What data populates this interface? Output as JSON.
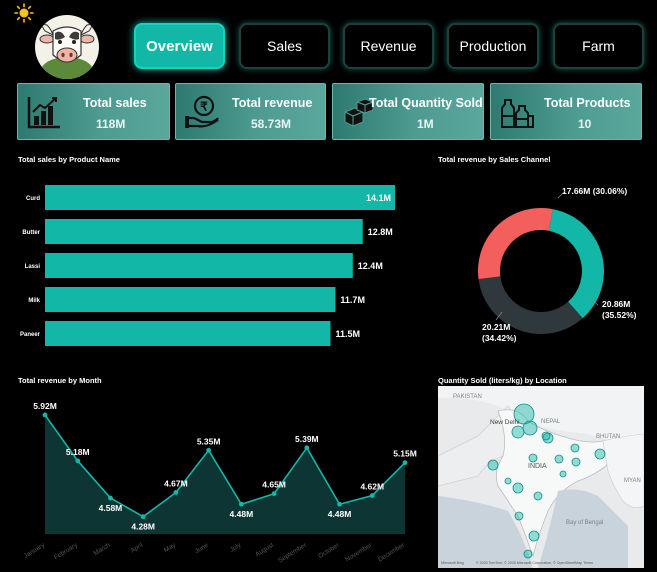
{
  "nav": {
    "tabs": [
      {
        "label": "Overview",
        "active": true
      },
      {
        "label": "Sales"
      },
      {
        "label": "Revenue"
      },
      {
        "label": "Production"
      },
      {
        "label": "Farm"
      }
    ]
  },
  "kpis": [
    {
      "title": "Total sales",
      "value": "118M",
      "icon": "bar-chart-icon"
    },
    {
      "title": "Total revenue",
      "value": "58.73M",
      "icon": "rupee-hand-icon"
    },
    {
      "title": "Total Quantity Sold",
      "value": "1M",
      "icon": "boxes-icon"
    },
    {
      "title": "Total Products",
      "value": "10",
      "icon": "milk-bottles-icon"
    }
  ],
  "colors": {
    "accent": "#13b7a8",
    "red": "#f25f5c",
    "dark": "#2f383d"
  },
  "sales_by_product": {
    "title": "Total sales by Product Name"
  },
  "revenue_by_channel": {
    "title": "Total revenue by Sales Channel"
  },
  "revenue_by_month": {
    "title": "Total revenue by Month"
  },
  "map": {
    "title": "Quantity Sold (liters/kg) by Location",
    "labels": {
      "pakistan": "PAKISTAN",
      "new_delhi": "New Delhi",
      "nepal": "NEPAL",
      "bhutan": "BHUTAN",
      "india": "INDIA",
      "bay": "Bay of Bengal",
      "myanmar": "MYAN"
    },
    "attribution": "© 2025 TomTom, © 2025 Microsoft Corporation, © OpenStreetMap  Terms",
    "bing": "Microsoft Bing"
  },
  "chart_data": [
    {
      "type": "bar",
      "title": "Total sales by Product Name",
      "categories": [
        "Curd",
        "Butter",
        "Lassi",
        "Milk",
        "Paneer"
      ],
      "values": [
        14.1,
        12.8,
        12.4,
        11.7,
        11.5
      ],
      "value_labels": [
        "14.1M",
        "12.8M",
        "12.4M",
        "11.7M",
        "11.5M"
      ],
      "orientation": "horizontal"
    },
    {
      "type": "pie",
      "title": "Total revenue by Sales Channel",
      "donut": true,
      "slices": [
        {
          "value": 20.86,
          "label": "20.86M (35.52%)",
          "color": "#13b7a8"
        },
        {
          "value": 20.21,
          "label": "20.21M (34.42%)",
          "color": "#2f383d"
        },
        {
          "value": 17.66,
          "label": "17.66M (30.06%)",
          "color": "#f25f5c"
        }
      ]
    },
    {
      "type": "area",
      "title": "Total revenue by Month",
      "categories": [
        "January",
        "February",
        "March",
        "April",
        "May",
        "June",
        "July",
        "August",
        "September",
        "October",
        "November",
        "December"
      ],
      "values": [
        5.92,
        5.18,
        4.58,
        4.28,
        4.67,
        5.35,
        4.48,
        4.65,
        5.39,
        4.48,
        4.62,
        5.15
      ],
      "value_labels": [
        "5.92M",
        "5.18M",
        "4.58M",
        "4.28M",
        "4.67M",
        "5.35M",
        "4.48M",
        "4.65M",
        "5.39M",
        "4.48M",
        "4.62M",
        "5.15M"
      ]
    }
  ]
}
